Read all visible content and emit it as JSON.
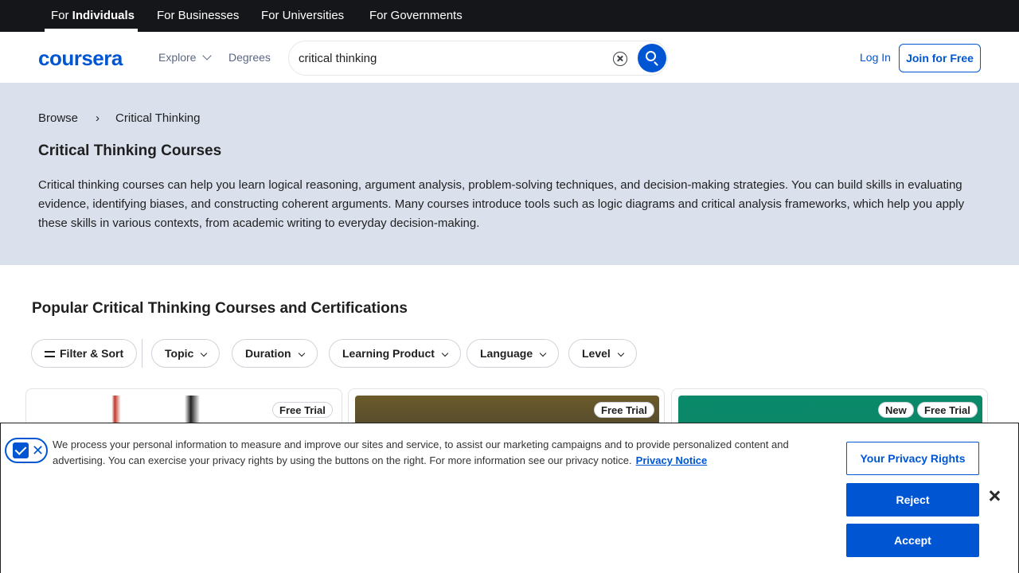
{
  "topbar": {
    "tabs": [
      {
        "prefix": "For ",
        "bold": "Individuals"
      },
      {
        "label": "For Businesses"
      },
      {
        "label": "For Universities"
      },
      {
        "label": "For Governments"
      }
    ]
  },
  "header": {
    "logo": "coursera",
    "explore": "Explore",
    "degrees": "Degrees",
    "search": {
      "value": "critical thinking"
    },
    "login": "Log In",
    "join": "Join for Free"
  },
  "hero": {
    "breadcrumb": {
      "root": "Browse",
      "separator": "›",
      "current": "Critical Thinking"
    },
    "title": "Critical Thinking Courses",
    "description": "Critical thinking courses can help you learn logical reasoning, argument analysis, problem-solving techniques, and decision-making strategies. You can build skills in evaluating evidence, identifying biases, and constructing coherent arguments. Many courses introduce tools such as logic diagrams and critical analysis frameworks, which help you apply these skills in various contexts, from academic writing to everyday decision-making."
  },
  "section": {
    "title": "Popular Critical Thinking Courses and Certifications",
    "filters": [
      "Filter & Sort",
      "Topic",
      "Duration",
      "Learning Product",
      "Language",
      "Level"
    ]
  },
  "cards": [
    {
      "badges": [
        "Free Trial"
      ]
    },
    {
      "badges": [
        "Free Trial"
      ]
    },
    {
      "badges": [
        "New",
        "Free Trial"
      ]
    }
  ],
  "cookie": {
    "text": "We process your personal information to measure and improve our sites and service, to assist our marketing campaigns and to provide personalized content and advertising. You can exercise your privacy rights by using the buttons on the right. For more information see our privacy notice.",
    "privacy_link": "Privacy Notice",
    "rights_button": "Your Privacy Rights",
    "reject_button": "Reject",
    "accept_button": "Accept"
  },
  "colors": {
    "brand": "#0056d2",
    "topbar": "#15161a",
    "hero_bg": "#dae1ed"
  }
}
